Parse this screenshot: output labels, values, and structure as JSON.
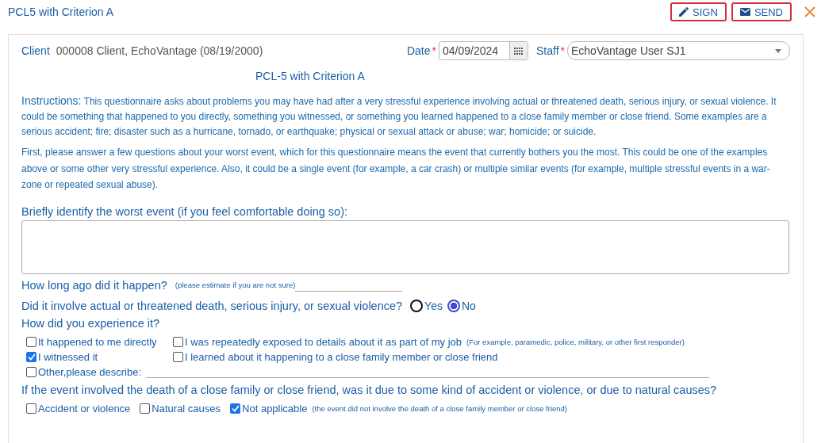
{
  "header": {
    "title": "PCL5 with Criterion A",
    "buttons": [
      {
        "kind": "sign",
        "label": "SIGN"
      },
      {
        "kind": "send",
        "label": "SEND"
      }
    ]
  },
  "client": {
    "label": "Client",
    "value": "000008 Client, EchoVantage (08/19/2000)"
  },
  "date": {
    "label": "Date",
    "required_mark": "*",
    "value": "04/09/2024"
  },
  "staff": {
    "label": "Staff",
    "required_mark": "*",
    "value": "EchoVantage User SJ1"
  },
  "form_title": "PCL-5 with Criterion A",
  "instructions": {
    "label": "Instructions:",
    "text": "This questionnaire asks about problems you may have had after a very stressful experience involving actual or threatened death, serious injury, or sexual violence. It could be something that happened to you directly, something you witnessed, or something you learned happened to a close family member or close friend. Some examples are a serious accident; fire; disaster such as a hurricane, tornado, or earthquake; physical or sexual attack or abuse; war; homicide; or suicide."
  },
  "paragraph": "First, please answer a few questions about your worst event, which for this questionnaire means the event that currently bothers you the most. This could be one of the examples above or some other very stressful experience. Also, it could be a single event (for example, a car crash) or multiple similar events (for example, multiple stressful events in a war-zone or repeated sexual abuse).",
  "worst_event": {
    "label": "Briefly identify the worst event (if you feel comfortable doing so):"
  },
  "how_long": {
    "label": "How long ago did it happen?",
    "hint": "(please estimate if you are not sure)"
  },
  "involve": {
    "label": "Did it involve actual or threatened death, serious injury, or sexual violence?",
    "options": [
      {
        "label": "Yes",
        "selected": false
      },
      {
        "label": "No",
        "selected": true
      }
    ]
  },
  "experience": {
    "label": "How did you experience it?",
    "options": [
      {
        "label": "It happened to me directly",
        "checked": false
      },
      {
        "label": "I was repeatedly exposed to details about it as part of my job",
        "checked": false,
        "note": "(For example, paramedic, police, military, or other first responder)"
      },
      {
        "label": "I witnessed it",
        "checked": true
      },
      {
        "label": "I learned about it happening to a close family member or close friend",
        "checked": false
      }
    ],
    "other": {
      "label": "Other,please describe:",
      "checked": false
    }
  },
  "death_cause": {
    "label": "If the event involved the death of a close family or close friend, was it due to some kind of accident or violence, or due to natural causes?",
    "options": [
      {
        "label": "Accident or violence",
        "checked": false
      },
      {
        "label": "Natural causes",
        "checked": false
      },
      {
        "label": "Not applicable",
        "checked": true,
        "note": "(the event did not involve the death of a close family member or close friend)"
      }
    ]
  }
}
